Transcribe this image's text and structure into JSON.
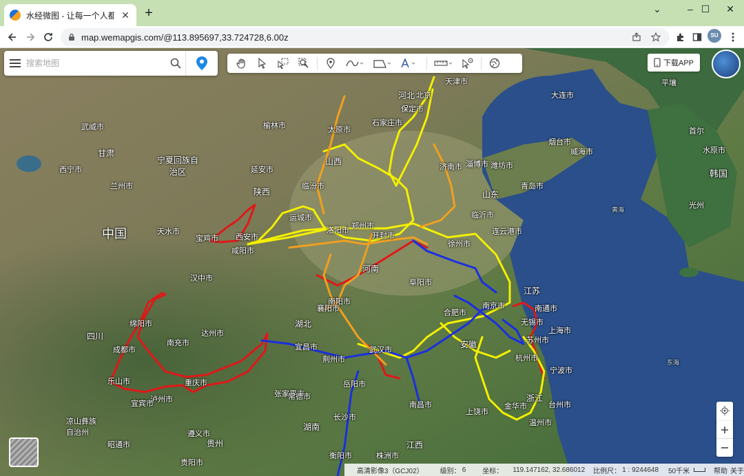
{
  "browser": {
    "tab_title": "水经微图 - 让每一个人都有自己",
    "tab_close": "✕",
    "new_tab": "+",
    "url": "map.wemapgis.com/@113.895697,33.724728,6.00z",
    "avatar": "SU",
    "window_controls": [
      "⌄",
      "–",
      "☐",
      "✕"
    ]
  },
  "search": {
    "placeholder": "搜索地图"
  },
  "app_button": {
    "label": "下载APP"
  },
  "status": {
    "layer": "高清影像3（GCJ02）",
    "level_label": "级别：",
    "level_value": "6",
    "coord_label": "坐标：",
    "coord_value": "119.147162, 32.686012",
    "scale_label": "比例尺：",
    "scale_value": "1 : 9244648",
    "scale_bar": "50千米",
    "help": "帮助",
    "about": "关于"
  },
  "map_labels": {
    "country": "中国",
    "korea": "韩国",
    "yellow_sea": "黄海",
    "east_sea": "东海",
    "places": [
      "天津市",
      "北京",
      "河北",
      "保定市",
      "石家庄市",
      "太原市",
      "大连市",
      "平壤",
      "首尔",
      "水原市",
      "光州",
      "烟台市",
      "威海市",
      "青岛市",
      "潍坊市",
      "济南市",
      "淄博市",
      "山东",
      "临沂市",
      "连云港市",
      "徐州市",
      "江苏",
      "南通市",
      "上海市",
      "无锡市",
      "苏州市",
      "杭州市",
      "宁波市",
      "浙江",
      "台州市",
      "温州市",
      "金华市",
      "安徽",
      "合肥市",
      "南京市",
      "阜阳市",
      "河南",
      "郑州市",
      "开封市",
      "洛阳市",
      "运城市",
      "临汾市",
      "山西",
      "陕西",
      "西安市",
      "咸阳市",
      "宝鸡市",
      "延安市",
      "榆林市",
      "宁夏回族自治区",
      "甘肃",
      "兰州市",
      "西宁市",
      "武威市",
      "天水市",
      "汉中市",
      "南阳市",
      "襄阳市",
      "湖北",
      "宜昌市",
      "荆州市",
      "武汉市",
      "长沙市",
      "湖南",
      "岳阳市",
      "南昌市",
      "江西",
      "上饶市",
      "衡阳市",
      "四川",
      "绵阳市",
      "成都市",
      "乐山市",
      "南充市",
      "达州市",
      "重庆市",
      "宜宾市",
      "泸州市",
      "张家界市",
      "遵义市",
      "贵州",
      "凉山彝族自治州",
      "昭通市",
      "贵阳市",
      "常德市",
      "株洲市"
    ]
  },
  "icons": {
    "menu": "menu-icon",
    "search": "search-icon",
    "pin": "location-pin-icon",
    "tools": [
      "hand-pan-icon",
      "pointer-icon",
      "box-select-icon",
      "zoom-select-icon",
      "marker-icon",
      "curve-icon",
      "polygon-icon",
      "text-icon",
      "measure-icon",
      "identify-icon",
      "globe-icon"
    ]
  },
  "colors": {
    "route_red": "#e01818",
    "route_yellow": "#f4f000",
    "route_orange": "#f0a020",
    "route_blue": "#1a2fe0",
    "pin_blue": "#1e88e5",
    "titlebar": "#c6e0b4"
  }
}
